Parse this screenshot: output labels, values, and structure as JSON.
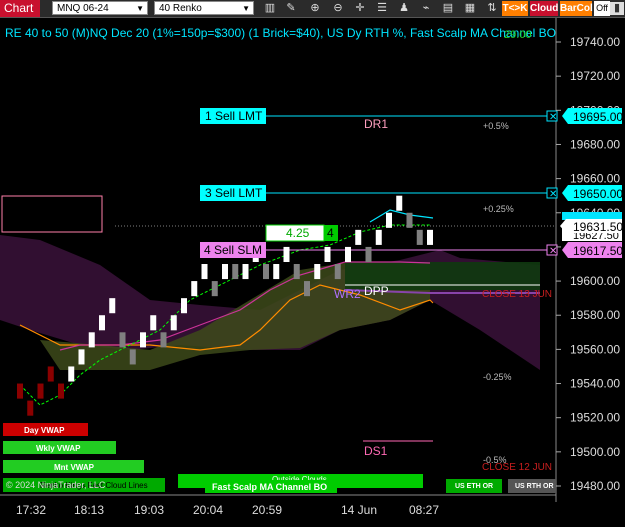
{
  "toolbar": {
    "chart_label": "Chart",
    "instrument": "MNQ 06-24",
    "bar_type": "40 Renko",
    "icons": [
      "bar-style-icon",
      "drawing-tools-icon",
      "zoom-in-icon",
      "zoom-out-icon",
      "crosshair-icon",
      "properties-icon",
      "strategies-icon",
      "indicators-icon",
      "templates-icon",
      "data-box-icon",
      "chart-trader-icon",
      "share-icon"
    ],
    "tk_button": "T<>K",
    "cloud_button": "Cloud",
    "barcol_button": "BarCol",
    "off_button": "Off"
  },
  "chart_header": {
    "info": "RE 40 to 50 (M)NQ Dec 20 (1%=150p=$300) (1 Brick=$40), US Dy RTH %, Fast Scalp MA Channel BO",
    "overlay_value": "29.00"
  },
  "orders": [
    {
      "label": "1 Sell LMT",
      "price": "19695.00"
    },
    {
      "label": "3 Sell LMT",
      "price": "19650.00"
    },
    {
      "label": "4 Sell SLM",
      "price": "19617.50"
    }
  ],
  "position": {
    "pnl": "4.25",
    "qty": "4"
  },
  "last_price": "19631.50",
  "position_price": "19627.50",
  "level_labels": {
    "dr1": "DR1",
    "ds1": "DS1",
    "wr2": "WR2",
    "dpp": "DPP"
  },
  "pct_labels": [
    "+0.5%",
    "+0.25%",
    "-0.25%",
    "-0.5%"
  ],
  "close_labels": [
    "CLOSE 13 JUN",
    "CLOSE 12 JUN"
  ],
  "legend_buttons": [
    {
      "label": "Day VWAP",
      "color": "#cc0000"
    },
    {
      "label": "Wkly VWAP",
      "color": "#22cc22"
    },
    {
      "label": "Mnt VWAP",
      "color": "#22cc22"
    },
    {
      "label": "Fast Scalp MA Channel BO",
      "color": "#00cc00"
    },
    {
      "label": "Outside Clouds",
      "color": "#00cc00"
    },
    {
      "label": "US ETH OR",
      "color": "#00aa00"
    },
    {
      "label": "US RTH OR",
      "color": "#555555"
    }
  ],
  "copyright": "© 2024 NinjaTrader, LLC",
  "overlap_text": "Renko Kings Fast Cloud Lines",
  "price_axis": [
    "19740.00",
    "19720.00",
    "19700.00",
    "19680.00",
    "19660.00",
    "19640.00",
    "19620.00",
    "19600.00",
    "19580.00",
    "19560.00",
    "19540.00",
    "19520.00",
    "19500.00",
    "19480.00"
  ],
  "time_axis": [
    "17:32",
    "18:13",
    "19:03",
    "20:04",
    "20:59",
    "14 Jun",
    "08:27"
  ],
  "chart_data": {
    "type": "renko",
    "brick_size": 10,
    "bricks": [
      {
        "o": 19540,
        "c": 19530,
        "dir": "down"
      },
      {
        "o": 19530,
        "c": 19520,
        "dir": "down"
      },
      {
        "o": 19540,
        "c": 19530,
        "dir": "down"
      },
      {
        "o": 19550,
        "c": 19540,
        "dir": "down"
      },
      {
        "o": 19540,
        "c": 19530,
        "dir": "down"
      },
      {
        "o": 19540,
        "c": 19550,
        "dir": "up"
      },
      {
        "o": 19550,
        "c": 19560,
        "dir": "up"
      },
      {
        "o": 19560,
        "c": 19570,
        "dir": "up"
      },
      {
        "o": 19570,
        "c": 19580,
        "dir": "up"
      },
      {
        "o": 19580,
        "c": 19590,
        "dir": "up"
      },
      {
        "o": 19570,
        "c": 19560,
        "dir": "down"
      },
      {
        "o": 19560,
        "c": 19550,
        "dir": "down"
      },
      {
        "o": 19560,
        "c": 19570,
        "dir": "up"
      },
      {
        "o": 19570,
        "c": 19580,
        "dir": "up"
      },
      {
        "o": 19570,
        "c": 19560,
        "dir": "down"
      },
      {
        "o": 19570,
        "c": 19580,
        "dir": "up"
      },
      {
        "o": 19580,
        "c": 19590,
        "dir": "up"
      },
      {
        "o": 19590,
        "c": 19600,
        "dir": "up"
      },
      {
        "o": 19600,
        "c": 19610,
        "dir": "up"
      },
      {
        "o": 19600,
        "c": 19590,
        "dir": "down"
      },
      {
        "o": 19600,
        "c": 19610,
        "dir": "up"
      },
      {
        "o": 19610,
        "c": 19600,
        "dir": "down"
      },
      {
        "o": 19600,
        "c": 19610,
        "dir": "up"
      },
      {
        "o": 19610,
        "c": 19620,
        "dir": "up"
      },
      {
        "o": 19610,
        "c": 19600,
        "dir": "down"
      },
      {
        "o": 19600,
        "c": 19610,
        "dir": "up"
      },
      {
        "o": 19610,
        "c": 19620,
        "dir": "up"
      },
      {
        "o": 19610,
        "c": 19600,
        "dir": "down"
      },
      {
        "o": 19600,
        "c": 19590,
        "dir": "down"
      },
      {
        "o": 19600,
        "c": 19610,
        "dir": "up"
      },
      {
        "o": 19610,
        "c": 19620,
        "dir": "up"
      },
      {
        "o": 19610,
        "c": 19600,
        "dir": "down"
      },
      {
        "o": 19610,
        "c": 19620,
        "dir": "up"
      },
      {
        "o": 19620,
        "c": 19630,
        "dir": "up"
      },
      {
        "o": 19620,
        "c": 19610,
        "dir": "down"
      },
      {
        "o": 19620,
        "c": 19630,
        "dir": "up"
      },
      {
        "o": 19630,
        "c": 19640,
        "dir": "up"
      },
      {
        "o": 19640,
        "c": 19650,
        "dir": "up"
      },
      {
        "o": 19640,
        "c": 19630,
        "dir": "down"
      },
      {
        "o": 19630,
        "c": 19620,
        "dir": "down"
      },
      {
        "o": 19620,
        "c": 19630,
        "dir": "up"
      }
    ],
    "ylim": [
      19480,
      19750
    ]
  },
  "colors": {
    "up_brick": "#ffffff",
    "down_brick": "#808080",
    "down_brick_early": "#8b0000",
    "order_line": "#00e5ff",
    "order_label_bg": "#00ffff",
    "slm_label_bg": "#ee82ee",
    "cloud_green": "#556b2f",
    "cloud_purple": "#4b1a4b",
    "vwap_orange": "#ff8c00",
    "ma_green": "#00ff00"
  }
}
